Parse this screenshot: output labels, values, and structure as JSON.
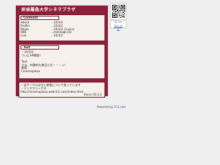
{
  "site": {
    "title": "探偵羅偽大学シネマプラザ"
  },
  "contents": {
    "heading": "Contents",
    "rows": [
      {
        "label": "About",
        "value": "...10/3/2"
      },
      {
        "label": "Profile",
        "value": "...10/3/2"
      },
      {
        "label": "Photo",
        "value": "...10/3/2 (3 pics)"
      },
      {
        "label": "BBS",
        "value": "...message pls"
      },
      {
        "label": "Link",
        "value": "...10/3/2"
      }
    ]
  },
  "text": {
    "heading": "Text",
    "lines": [
      "・10/3/2",
      "ついにHP開設！",
      "",
      "Text",
      "さぁ、刺激的な毎日だぜ・・・ッ！",
      "新版",
      "Cinemaplaza"
    ]
  },
  "notice": {
    "lines": [
      "・当サークルは主に新版について扱っています",
      "・リンクフリーです",
      "http://cinemaplaza.web.fc2.com/index.html"
    ],
    "since": "Since 10.3.2"
  },
  "qr": {
    "caption": "Powered by FC2 QR Code",
    "link": "携帯に送る"
  },
  "footer": {
    "prefix": "Powered by",
    "link": "FC2.com"
  }
}
